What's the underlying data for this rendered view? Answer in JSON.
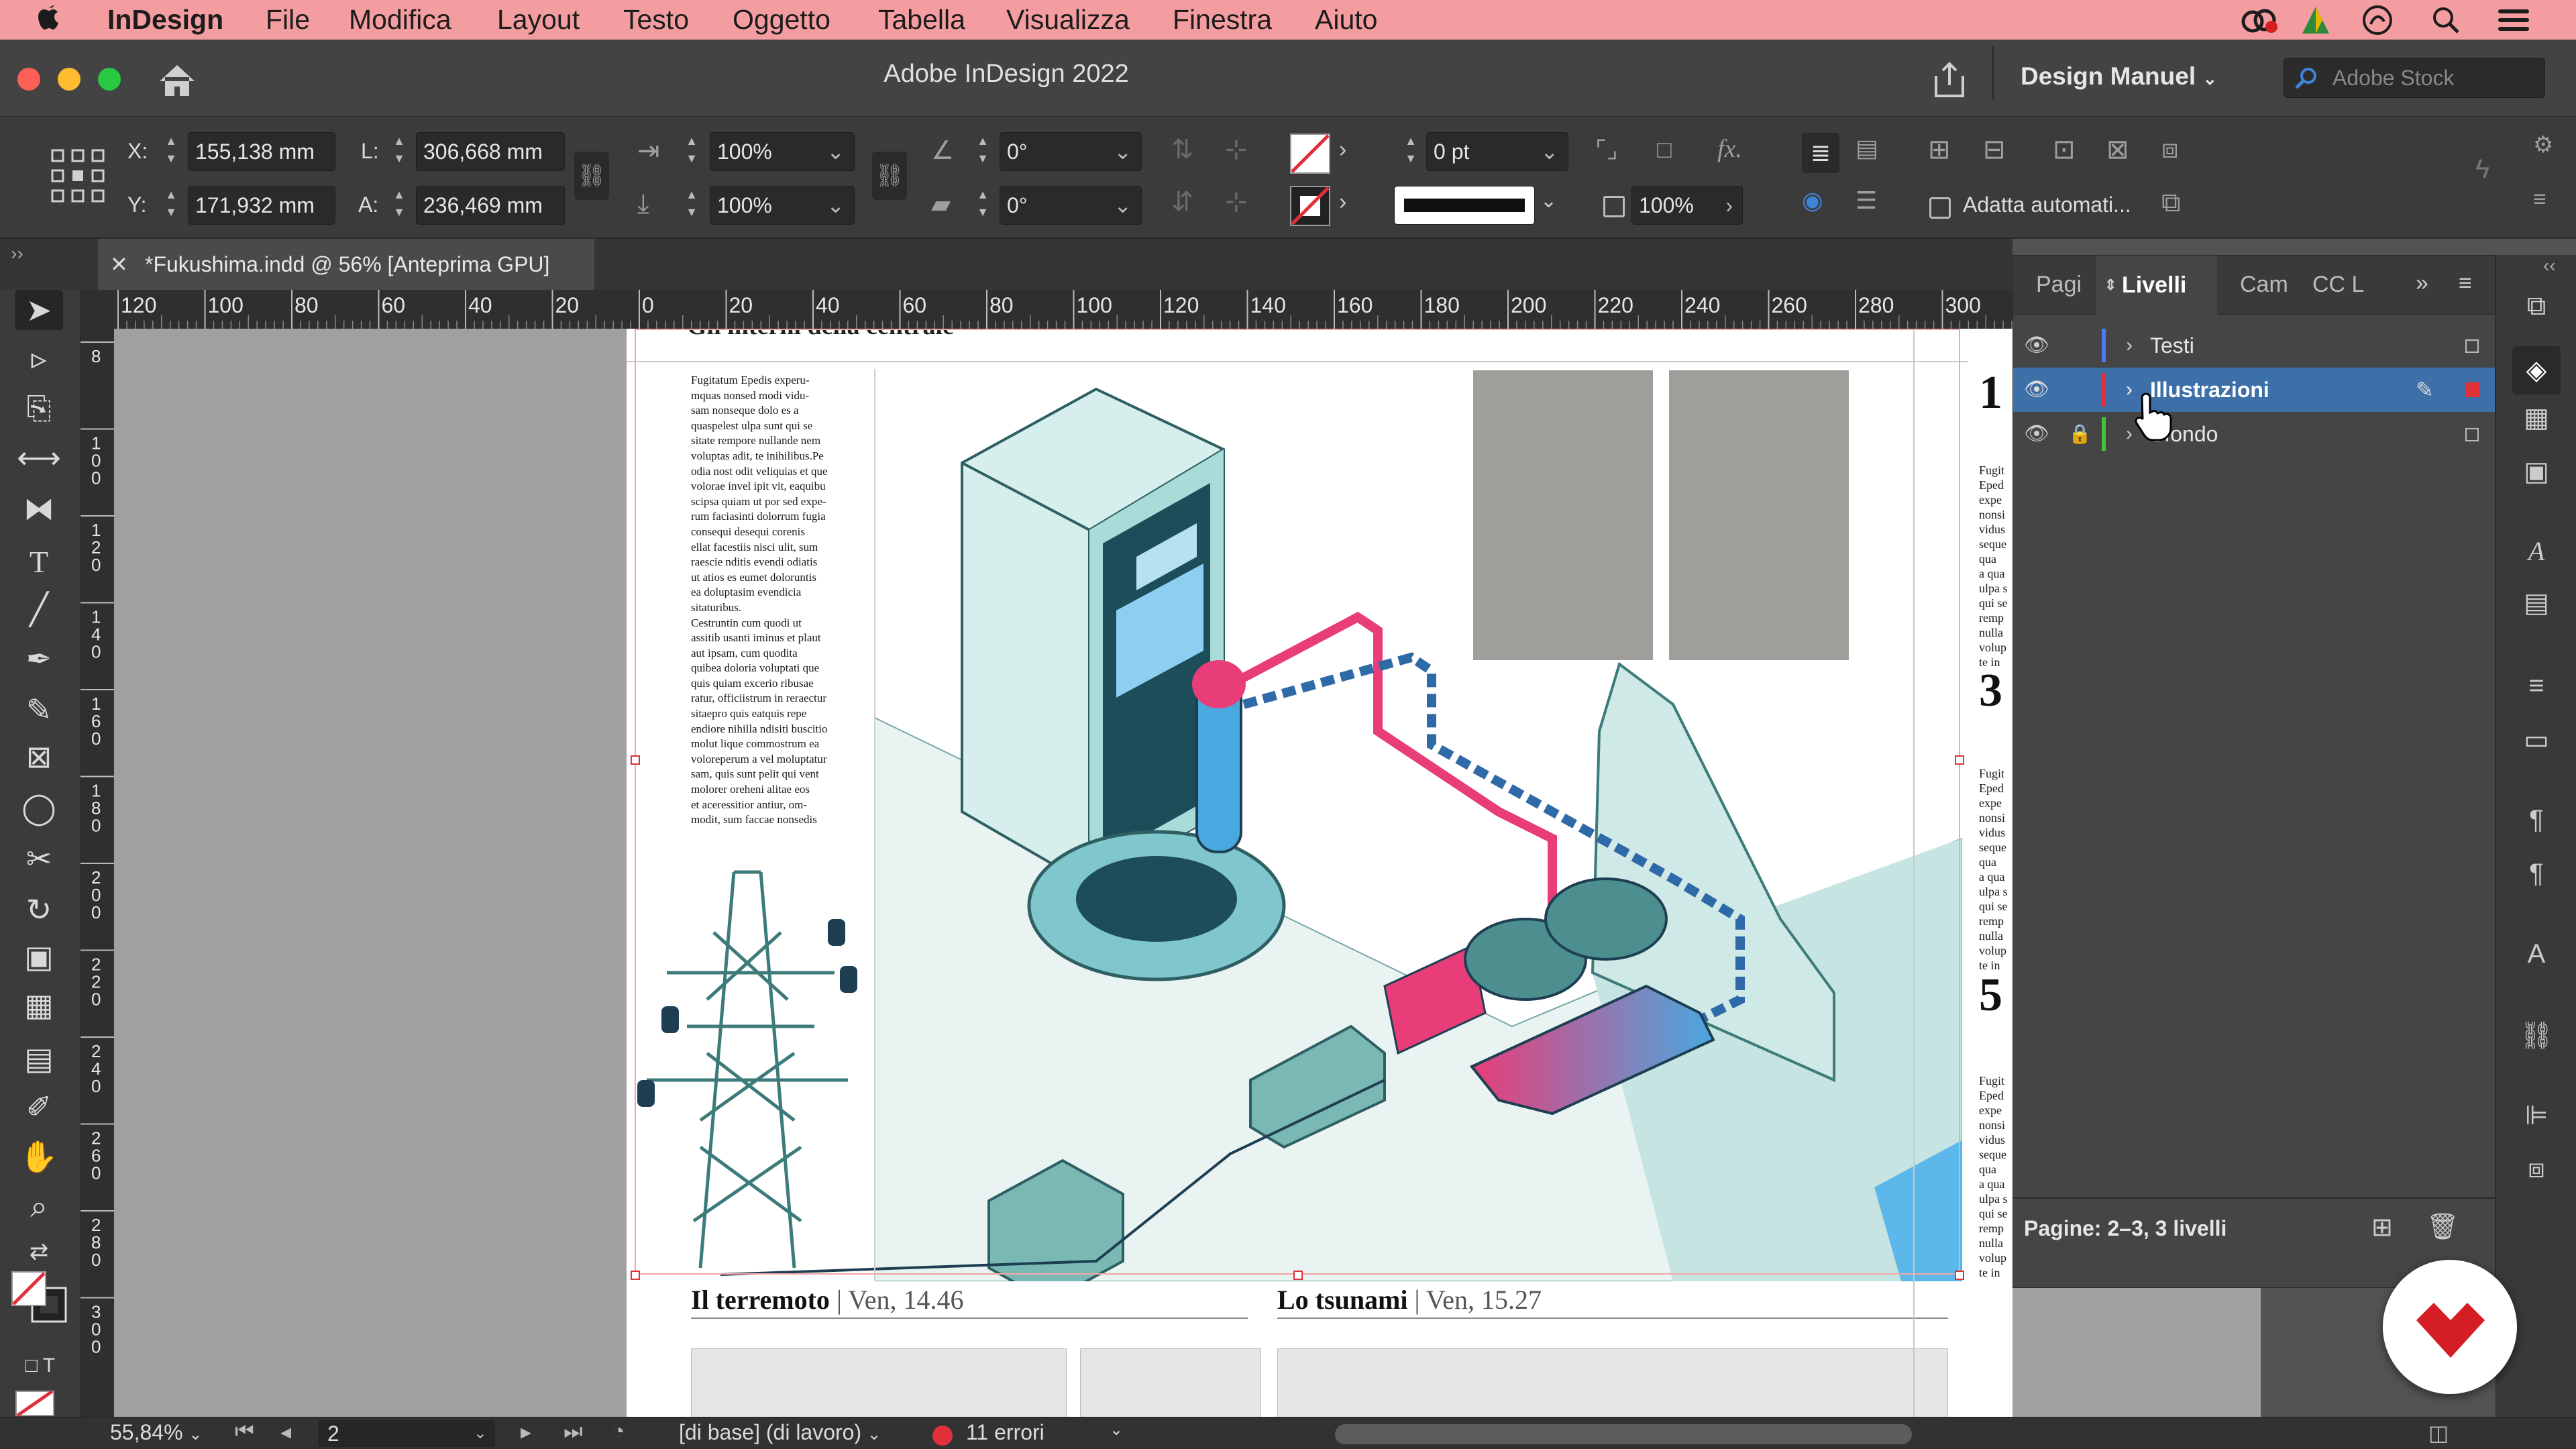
{
  "menubar": {
    "app_name": "InDesign",
    "items": [
      "File",
      "Modifica",
      "Layout",
      "Testo",
      "Oggetto",
      "Tabella",
      "Visualizza",
      "Finestra",
      "Aiuto"
    ]
  },
  "titlebar": {
    "title": "Adobe InDesign 2022",
    "workspace": "Design Manuel",
    "stock_placeholder": "Adobe Stock"
  },
  "control": {
    "x_label": "X:",
    "x_value": "155,138 mm",
    "y_label": "Y:",
    "y_value": "171,932 mm",
    "w_label": "L:",
    "w_value": "306,668 mm",
    "h_label": "A:",
    "h_value": "236,469 mm",
    "scale_x": "100%",
    "scale_y": "100%",
    "rotation": "0°",
    "shear": "0°",
    "stroke_weight": "0 pt",
    "opacity": "100%",
    "autofit_label": "Adatta automati..."
  },
  "document_tab": {
    "title": "*Fukushima.indd @ 56% [Anteprima GPU]"
  },
  "ruler": {
    "h_ticks": [
      "120",
      "100",
      "80",
      "60",
      "40",
      "20",
      "0",
      "20",
      "40",
      "60",
      "80",
      "100",
      "120",
      "140",
      "160",
      "180",
      "200",
      "220",
      "240",
      "260",
      "280",
      "300"
    ],
    "v_ticks": [
      "8",
      "1 0 0",
      "1 2 0",
      "1 4 0",
      "1 6 0",
      "1 8 0",
      "2 0 0",
      "2 2 0",
      "2 4 0",
      "2 6 0",
      "2 8 0",
      "3 0 0"
    ]
  },
  "page": {
    "headline_partial": "Gli interni della centrale",
    "body_text": "Fugitatum Epedis experu-\nmquas nonsed modi vidu-\nsam nonseque dolo es a\nquaspelest ulpa sunt qui se\nsitate rempore nullande nem\nvoluptas adit, te inihilibus.Pe\nodia nost odit veliquias et que\nvolorae invel ipit vit, eaquibu\nscipsa quiam ut por sed expe-\nrum faciasinti dolorrum fugia\nconsequi desequi corenis\nellat facestiis nisci ulit, sum\nraescie nditis evendi odiatis\nut atios es eumet doloruntis\nea doluptasim evendicia\nsitaturibus.\nCestruntin cum quodi ut\nassitib usanti iminus et plaut\naut ipsam, cum quodita\nquibea doloria voluptati que\nquis quiam excerio ribusae\nratur, officiistrum in reraectur\nsitaepro quis eatquis repe\nendiore nihilla ndisiti buscitio\nmolut lique commostrum ea\nvoloreperum a vel moluptatur\nsam, quis sunt pelit qui vent\nmolorer oreheni alitae eos\net aceressitior antiur, om-\nmodit, sum faccae nonsedis",
    "caption_left_bold": "Il terremoto",
    "caption_left_time": "Ven, 14.46",
    "caption_right_bold": "Lo tsunami",
    "caption_right_time": "Ven, 15.27",
    "right_numbers": [
      "1",
      "3",
      "5"
    ],
    "right_snippet": "Fugit\nEped\nexpe\nnonsi\nvidus\nseque\nqua\na qua\nulpa s\nqui se\nremp\nnulla\nvolup\nte in"
  },
  "layers_panel": {
    "tabs": [
      "Pagi",
      "Livelli",
      "Cam",
      "CC L"
    ],
    "active_tab": "Livelli",
    "layers": [
      {
        "name": "Testi",
        "color": "#4a7bf0",
        "locked": false,
        "selected": false
      },
      {
        "name": "Illustrazioni",
        "color": "#e0303a",
        "locked": false,
        "selected": true
      },
      {
        "name": "Sfondo",
        "color": "#43c43a",
        "locked": true,
        "selected": false
      }
    ],
    "footer": "Pagine: 2–3, 3 livelli"
  },
  "status": {
    "zoom": "55,84%",
    "page": "2",
    "preflight_profile": "[di base] (di lavoro)",
    "errors": "11 errori",
    "error_color": "#e0303a"
  },
  "colors": {
    "menubar": "#f49da0",
    "selection": "#3d6fa8",
    "teal": "#a9dcd8"
  }
}
